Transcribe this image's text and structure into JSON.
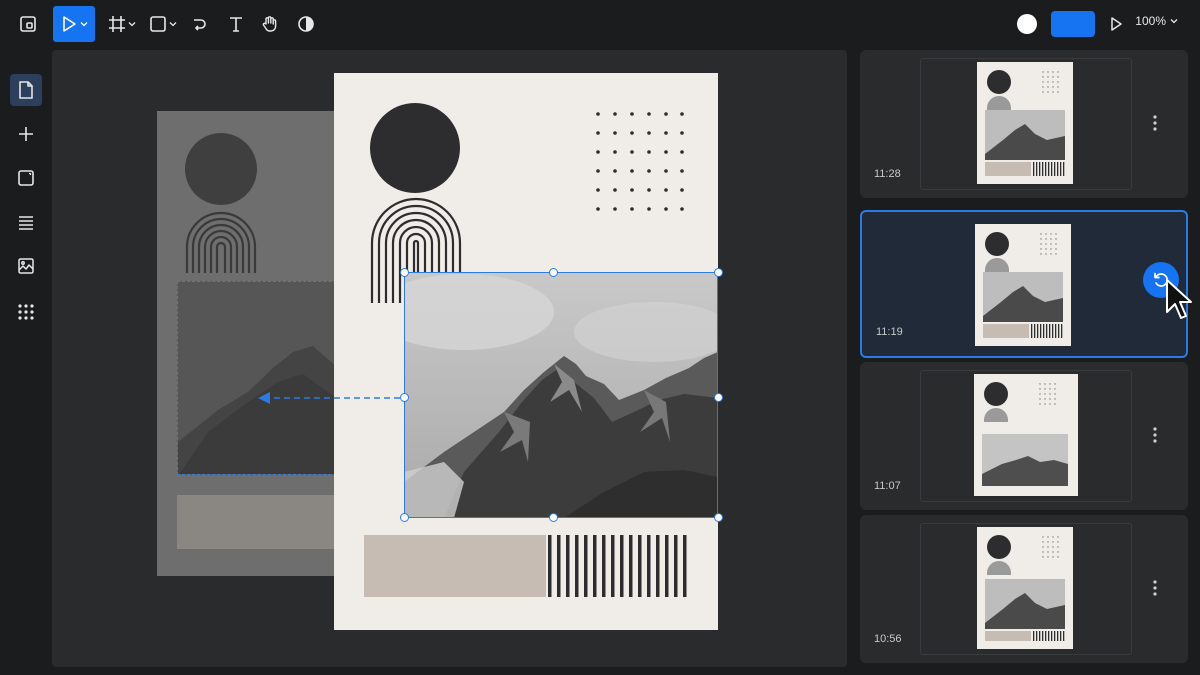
{
  "toolbar": {
    "zoom_label": "100%",
    "tools": [
      "rectangle-select",
      "move",
      "frame",
      "shape",
      "pen",
      "text",
      "hand",
      "contrast"
    ]
  },
  "sidebar": {
    "items": [
      "pages-icon",
      "add-icon",
      "frame-icon",
      "layers-icon",
      "image-icon",
      "apps-icon"
    ]
  },
  "history": {
    "items": [
      {
        "time": "11:28",
        "selected": false
      },
      {
        "time": "11:19",
        "selected": true
      },
      {
        "time": "11:07",
        "selected": false
      },
      {
        "time": "10:56",
        "selected": false
      }
    ]
  },
  "colors": {
    "accent": "#1673f2",
    "canvas": "#2a2b2d",
    "poster": "#f0ede8",
    "bar": "#c6bcb3"
  }
}
